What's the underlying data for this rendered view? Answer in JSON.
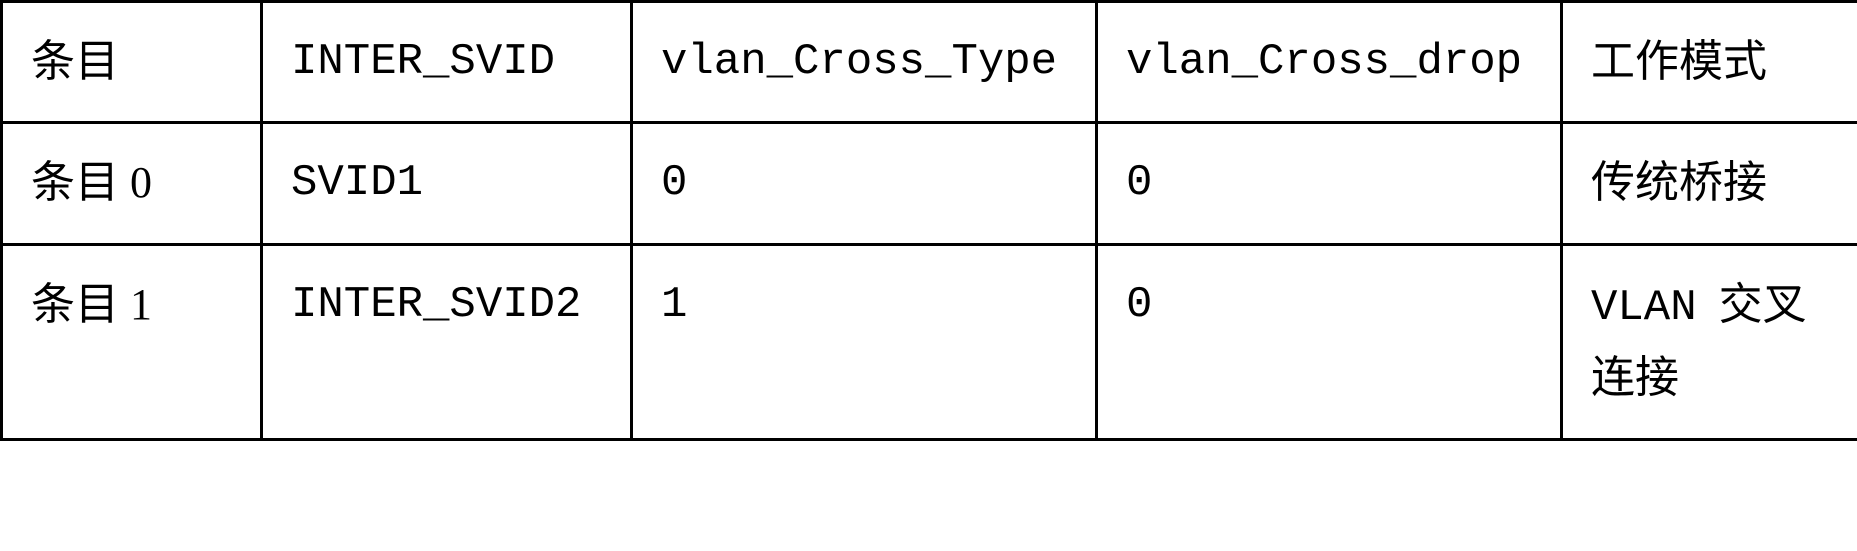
{
  "chart_data": {
    "type": "table",
    "headers": [
      "条目",
      "INTER_SVID",
      "vlan_Cross_Type",
      "vlan_Cross_drop",
      "工作模式"
    ],
    "rows": [
      [
        "条目 0",
        "SVID1",
        "0",
        "0",
        "传统桥接"
      ],
      [
        "条目 1",
        "INTER_SVID2",
        "1",
        "0",
        "VLAN 交叉连接"
      ]
    ]
  },
  "table": {
    "header": {
      "c0": "条目",
      "c1": "INTER_SVID",
      "c2": "vlan_Cross_Type",
      "c3": "vlan_Cross_drop",
      "c4": "工作模式"
    },
    "row0": {
      "c0": "条目 0",
      "c1": "SVID1",
      "c2": "0",
      "c3": "0",
      "c4": "传统桥接"
    },
    "row1": {
      "c0": "条目 1",
      "c1": "INTER_SVID2",
      "c2": "1",
      "c3": "0",
      "c4_latin": "VLAN",
      "c4_cjk": "交叉连接"
    }
  }
}
